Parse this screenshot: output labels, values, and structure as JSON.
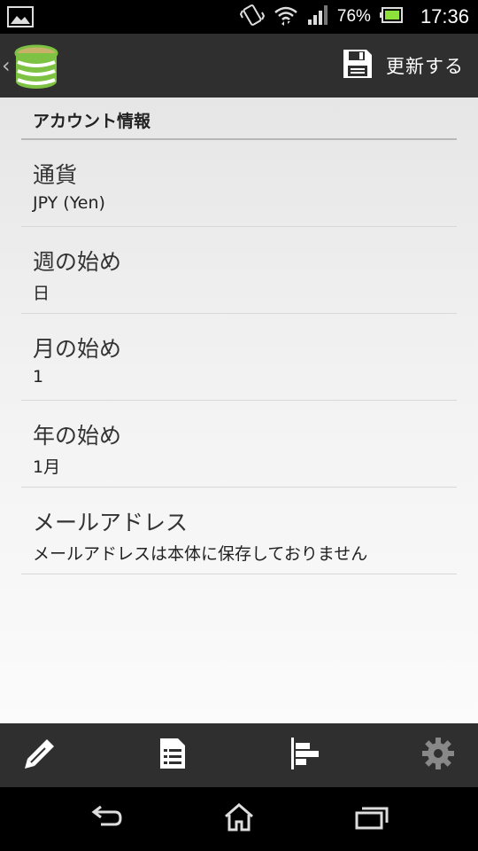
{
  "status_bar": {
    "battery_percent": "76%",
    "time": "17:36",
    "icons": [
      "gallery-icon",
      "vibrate-icon",
      "wifi-icon",
      "signal-icon",
      "battery-icon"
    ]
  },
  "action_bar": {
    "update_label": "更新する",
    "icons": [
      "app-logo-icon",
      "save-icon"
    ]
  },
  "section": {
    "title": "アカウント情報"
  },
  "preferences": [
    {
      "title": "通貨",
      "summary": "JPY (Yen)"
    },
    {
      "title": "週の始め",
      "summary": "日"
    },
    {
      "title": "月の始め",
      "summary": "1"
    },
    {
      "title": "年の始め",
      "summary": "1月"
    },
    {
      "title": "メールアドレス",
      "summary": "メールアドレスは本体に保存しておりません"
    }
  ],
  "bottom_bar": {
    "icons": [
      "pen-icon",
      "list-icon",
      "bar-chart-icon",
      "gear-icon"
    ]
  },
  "nav_bar": {
    "icons": [
      "back-icon",
      "home-icon",
      "recent-apps-icon"
    ]
  },
  "colors": {
    "bar_dark": "#2f2f2f",
    "logo_green": "#7dc242",
    "logo_gold": "#c8b26a",
    "battery_green": "#8ee03a"
  }
}
